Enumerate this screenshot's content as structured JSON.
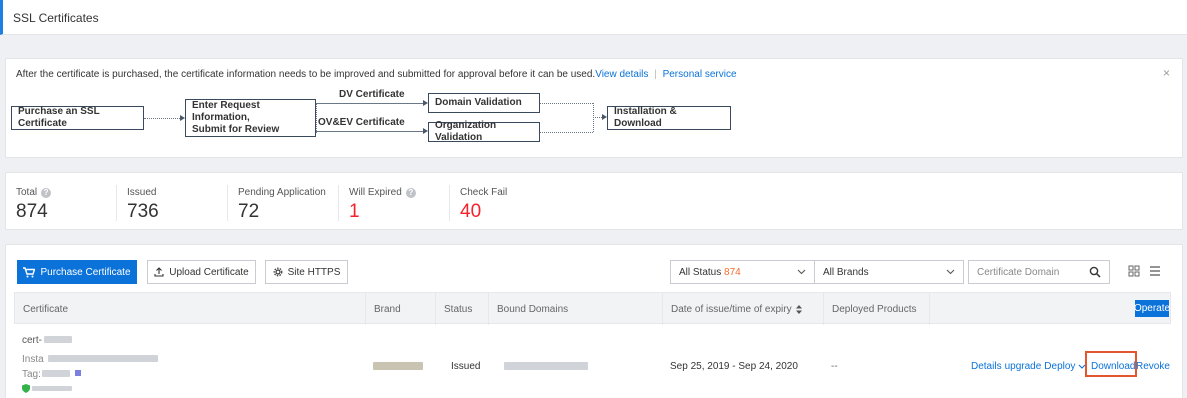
{
  "page": {
    "title": "SSL Certificates"
  },
  "notice": {
    "text": "After the certificate is purchased, the certificate information needs to be improved and submitted for approval before it can be used.",
    "view_details": "View details",
    "separator": "|",
    "personal_service": "Personal service",
    "close": "×",
    "flow": {
      "purchase": "Purchase an SSL Certificate",
      "enter_info_1": "Enter Request Information,",
      "enter_info_2": "Submit for Review",
      "dv_label": "DV Certificate",
      "ovev_label": "OV&EV Certificate",
      "domain_validation": "Domain Validation",
      "org_validation": "Organization Validation",
      "install": "Installation & Download"
    }
  },
  "stats": [
    {
      "label": "Total",
      "value": "874",
      "color": "#333333",
      "help": true
    },
    {
      "label": "Issued",
      "value": "736",
      "color": "#333333",
      "help": false
    },
    {
      "label": "Pending Application",
      "value": "72",
      "color": "#333333",
      "help": false
    },
    {
      "label": "Will Expired",
      "value": "1",
      "color": "#f5222d",
      "help": true
    },
    {
      "label": "Check Fail",
      "value": "40",
      "color": "#f5222d",
      "help": false
    }
  ],
  "toolbar": {
    "purchase": "Purchase Certificate",
    "upload": "Upload Certificate",
    "site_https": "Site HTTPS",
    "status_label": "All Status",
    "status_count": "874",
    "brands": "All Brands",
    "domain_placeholder": "Certificate Domain"
  },
  "table": {
    "columns": [
      "Certificate",
      "Brand",
      "Status",
      "Bound Domains",
      "Date of issue/time of expiry",
      "Deployed Products"
    ],
    "operate": "Operate",
    "row": {
      "cert_prefix": "cert-",
      "inst_prefix": "Insta",
      "tag_prefix": "Tag:",
      "status": "Issued",
      "dates": "Sep 25, 2019 - Sep 24, 2020",
      "deployed": "--",
      "actions": {
        "details": "Details",
        "upgrade": "upgrade",
        "deploy": "Deploy",
        "download": "Download",
        "revoke": "Revoke"
      }
    }
  },
  "colors": {
    "accent": "#0a72d9",
    "alert": "#f5222d",
    "highlight": "#f56c2d"
  }
}
